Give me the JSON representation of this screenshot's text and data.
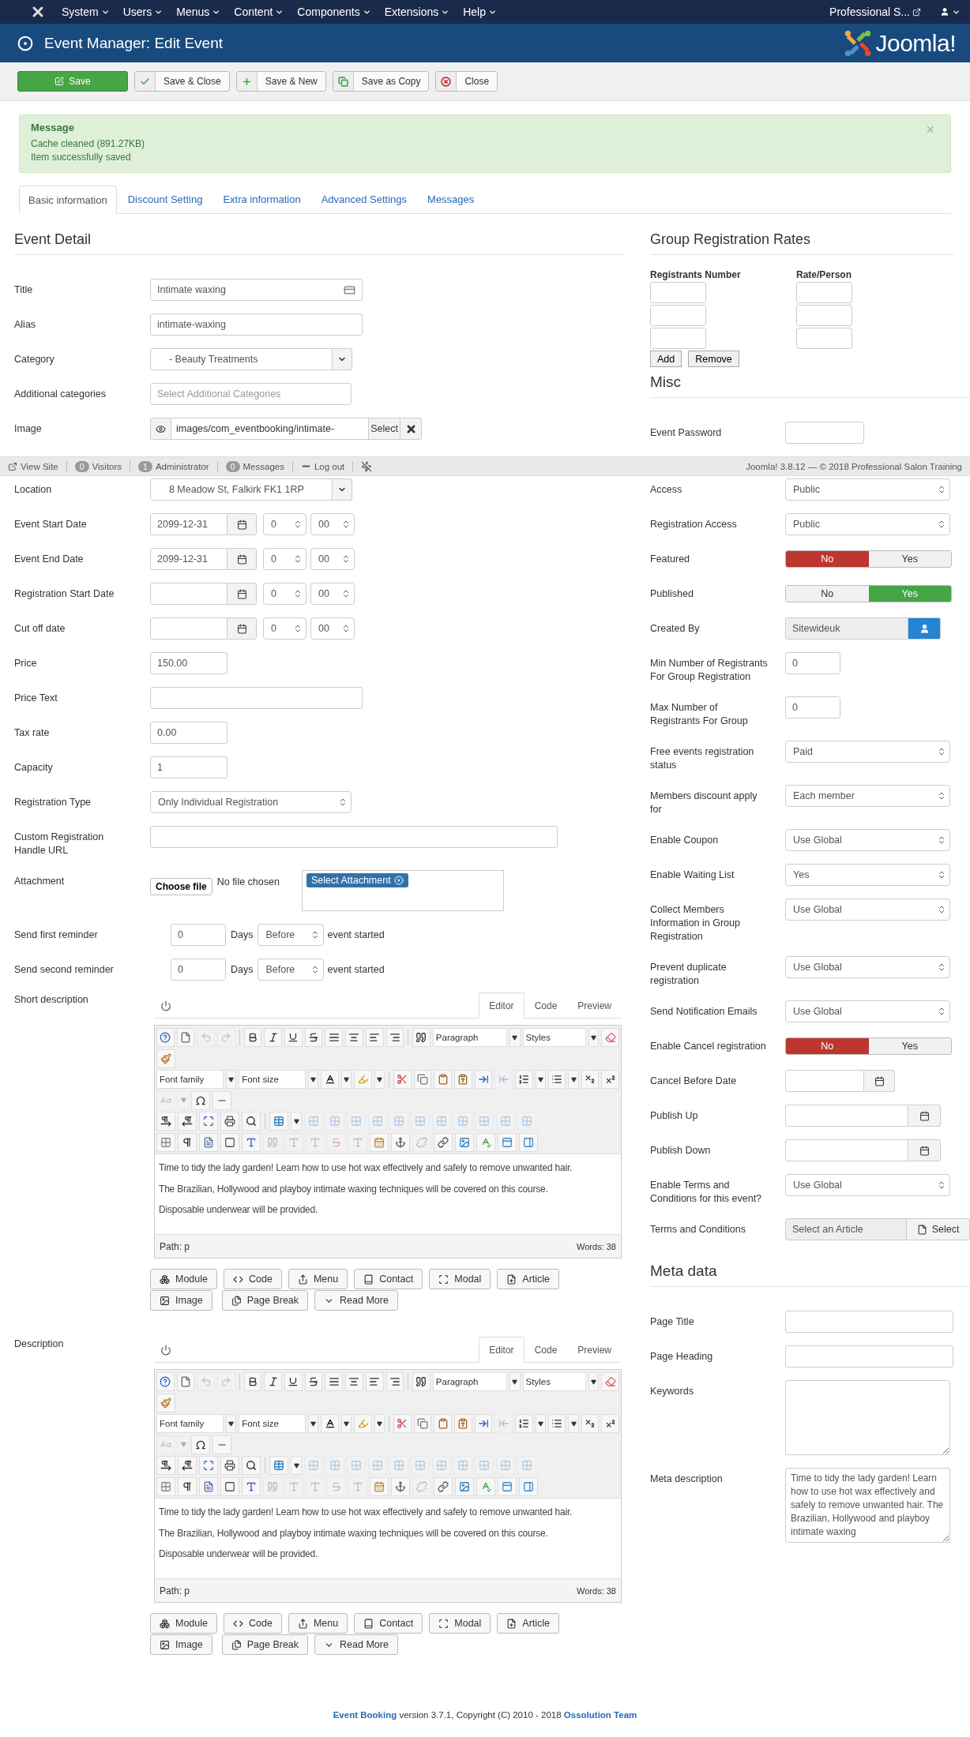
{
  "navbar": {
    "menus": [
      "System",
      "Users",
      "Menus",
      "Content",
      "Components",
      "Extensions",
      "Help"
    ],
    "site_link": "Professional S..."
  },
  "header": {
    "title": "Event Manager: Edit Event",
    "logo_text": "Joomla!"
  },
  "toolbar": [
    {
      "label": "Save",
      "kind": "save"
    },
    {
      "label": "Save & Close",
      "kind": "saveclose"
    },
    {
      "label": "Save & New",
      "kind": "savenew"
    },
    {
      "label": "Save as Copy",
      "kind": "copy"
    },
    {
      "label": "Close",
      "kind": "close"
    }
  ],
  "message": {
    "heading": "Message",
    "lines": [
      "Cache cleaned (891.27KB)",
      "Item successfully saved"
    ],
    "close": "×"
  },
  "tabs": [
    {
      "label": "Basic information",
      "selected": true
    },
    {
      "label": "Discount Setting",
      "selected": false
    },
    {
      "label": "Extra information",
      "selected": false
    },
    {
      "label": "Advanced Settings",
      "selected": false
    },
    {
      "label": "Messages",
      "selected": false
    }
  ],
  "event_detail": {
    "heading": "Event Detail",
    "rows_top": [
      {
        "kind": "iconfield",
        "label": "Title",
        "value": "Intimate waxing"
      },
      {
        "kind": "text",
        "label": "Alias",
        "value": "intimate-waxing"
      },
      {
        "kind": "combo",
        "label": "Category",
        "value": "- Beauty Treatments"
      },
      {
        "kind": "tags",
        "label": "Additional categories",
        "placeholder": "Select Additional Categories"
      },
      {
        "kind": "image",
        "label": "Image",
        "value": "images/com_eventbooking/intimate-",
        "button": "Select"
      }
    ],
    "rows": [
      {
        "kind": "combo",
        "label": "Location",
        "value": "8 Meadow St, Falkirk FK1 1RP"
      },
      {
        "kind": "date",
        "label": "Event Start Date",
        "value": "2099-12-31",
        "hour": "0",
        "minute": "00"
      },
      {
        "kind": "date",
        "label": "Event End Date",
        "value": "2099-12-31",
        "hour": "0",
        "minute": "00"
      },
      {
        "kind": "date",
        "label": "Registration Start Date",
        "hour": "0",
        "minute": "00"
      },
      {
        "kind": "date",
        "label": "Cut off date",
        "hour": "0",
        "minute": "00"
      },
      {
        "kind": "number",
        "label": "Price",
        "value": "150.00"
      },
      {
        "kind": "text",
        "label": "Price Text"
      },
      {
        "kind": "number",
        "label": "Tax rate",
        "value": "0.00"
      },
      {
        "kind": "number",
        "label": "Capacity",
        "value": "1"
      },
      {
        "kind": "select",
        "label": "Registration Type",
        "value": "Only Individual Registration"
      },
      {
        "kind": "url",
        "label": "Custom Registration Handle URL"
      },
      {
        "kind": "attachment",
        "label": "Attachment",
        "button": "Choose file",
        "status": "No file chosen",
        "tag": "Select Attachment"
      },
      {
        "kind": "reminder",
        "label": "Send first reminder",
        "value": "0",
        "unit": "Days",
        "when": "Before",
        "suffix": "event started"
      },
      {
        "kind": "reminder",
        "label": "Send second reminder",
        "value": "0",
        "unit": "Days",
        "when": "Before",
        "suffix": "event started"
      },
      {
        "kind": "editor",
        "label": "Short description",
        "tabs": [
          {
            "label": "Editor",
            "selected": true
          },
          {
            "label": "Code",
            "selected": false
          },
          {
            "label": "Preview",
            "selected": false
          }
        ],
        "selects": [
          "Paragraph",
          "Styles",
          "Font family",
          "Font size"
        ],
        "paragraphs": [
          "Time to tidy the lady garden! Learn how to use hot wax effectively and safely to remove unwanted hair.",
          "The Brazilian, Hollywood and playboy intimate waxing techniques will be covered on this course.",
          "Disposable underwear will be provided."
        ],
        "path": "Path: p",
        "words": "Words: 38",
        "buttons": [
          "Module",
          "Code",
          "Menu",
          "Contact",
          "Modal",
          "Article",
          "Image",
          "Page Break",
          "Read More"
        ]
      },
      {
        "kind": "editor",
        "label": "Description",
        "tabs": [
          {
            "label": "Editor",
            "selected": true
          },
          {
            "label": "Code",
            "selected": false
          },
          {
            "label": "Preview",
            "selected": false
          }
        ],
        "selects": [
          "Paragraph",
          "Styles",
          "Font family",
          "Font size"
        ],
        "paragraphs": [
          "Time to tidy the lady garden! Learn how to use hot wax effectively and safely to remove unwanted hair.",
          "The Brazilian, Hollywood and playboy intimate waxing techniques will be covered on this course.",
          "Disposable underwear will be provided."
        ],
        "path": "Path: p",
        "words": "Words: 38",
        "buttons": [
          "Module",
          "Code",
          "Menu",
          "Contact",
          "Modal",
          "Article",
          "Image",
          "Page Break",
          "Read More"
        ]
      }
    ]
  },
  "group_rates": {
    "heading": "Group Registration Rates",
    "columns": [
      "Registrants Number",
      "Rate/Person"
    ],
    "buttons": [
      "Add",
      "Remove"
    ]
  },
  "misc": {
    "heading": "Misc",
    "rows_top": [
      {
        "kind": "text",
        "label": "Event Password"
      }
    ],
    "rows": [
      {
        "kind": "select",
        "label": "Access",
        "value": "Public"
      },
      {
        "kind": "select",
        "label": "Registration Access",
        "value": "Public"
      },
      {
        "kind": "toggle",
        "label": "Featured",
        "options": [
          {
            "label": "No",
            "selected": true
          },
          {
            "label": "Yes",
            "selected": false
          }
        ]
      },
      {
        "kind": "toggle",
        "label": "Published",
        "options": [
          {
            "label": "No",
            "selected": false
          },
          {
            "label": "Yes",
            "selected": true
          }
        ]
      },
      {
        "kind": "author",
        "label": "Created By",
        "value": "Sitewideuk"
      },
      {
        "kind": "number",
        "label": "Min Number of Registrants For Group Registration",
        "value": "0"
      },
      {
        "kind": "number",
        "label": "Max Number of Registrants For Group",
        "value": "0"
      },
      {
        "kind": "select",
        "label": "Free events registration status",
        "value": "Paid"
      },
      {
        "kind": "select",
        "label": "Members discount apply for",
        "value": "Each member"
      },
      {
        "kind": "select",
        "label": "Enable Coupon",
        "value": "Use Global"
      },
      {
        "kind": "select",
        "label": "Enable Waiting List",
        "value": "Yes"
      },
      {
        "kind": "select",
        "label": "Collect Members Information in Group Registration",
        "value": "Use Global"
      },
      {
        "kind": "select",
        "label": "Prevent duplicate registration",
        "value": "Use Global"
      },
      {
        "kind": "select",
        "label": "Send Notification Emails",
        "value": "Use Global"
      },
      {
        "kind": "toggle",
        "label": "Enable Cancel registration",
        "options": [
          {
            "label": "No",
            "selected": true
          },
          {
            "label": "Yes",
            "selected": false
          }
        ]
      },
      {
        "kind": "shortdate",
        "label": "Cancel Before Date"
      },
      {
        "kind": "date",
        "label": "Publish Up"
      },
      {
        "kind": "date",
        "label": "Publish Down"
      },
      {
        "kind": "select",
        "label": "Enable Terms and Conditions for this event?",
        "value": "Use Global"
      },
      {
        "kind": "article",
        "label": "Terms and Conditions",
        "value": "Select an Article",
        "button": "Select"
      }
    ]
  },
  "meta": {
    "heading": "Meta data",
    "rows": [
      {
        "kind": "text",
        "label": "Page Title"
      },
      {
        "kind": "text",
        "label": "Page Heading"
      },
      {
        "kind": "textarea",
        "label": "Keywords"
      },
      {
        "kind": "textarea",
        "label": "Meta description",
        "value": "Time to tidy the lady garden! Learn how to use hot wax effectively and safely to remove unwanted hair. The Brazilian, Hollywood and playboy intimate waxing"
      }
    ]
  },
  "status_bar": {
    "items": [
      {
        "kind": "link",
        "label": "View Site"
      },
      {
        "kind": "count",
        "count": "0",
        "label": "Visitors"
      },
      {
        "kind": "count",
        "count": "1",
        "label": "Administrator"
      },
      {
        "kind": "count",
        "count": "0",
        "label": "Messages"
      },
      {
        "kind": "logout",
        "label": "Log out"
      }
    ],
    "version": "Joomla! 3.8.12 — © 2018 Professional Salon Training"
  },
  "footer": {
    "product": "Event Booking",
    "text": "version 3.7.1, Copyright (C) 2010 - 2018",
    "company": "Ossolution Team"
  }
}
